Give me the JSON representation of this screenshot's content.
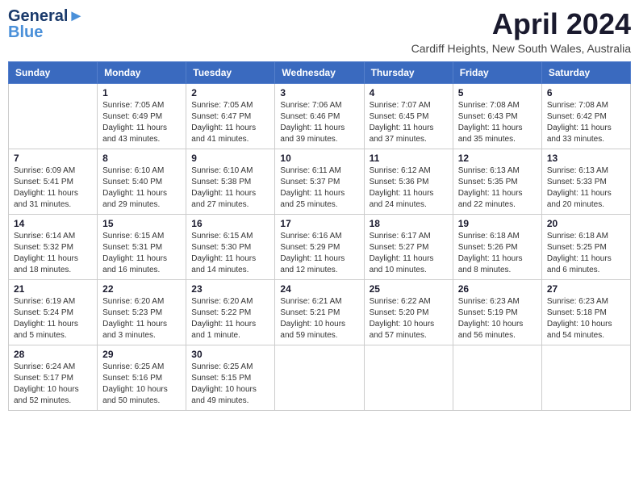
{
  "logo": {
    "line1": "General",
    "line2": "Blue"
  },
  "title": "April 2024",
  "location": "Cardiff Heights, New South Wales, Australia",
  "days_of_week": [
    "Sunday",
    "Monday",
    "Tuesday",
    "Wednesday",
    "Thursday",
    "Friday",
    "Saturday"
  ],
  "weeks": [
    [
      {
        "day": "",
        "info": ""
      },
      {
        "day": "1",
        "info": "Sunrise: 7:05 AM\nSunset: 6:49 PM\nDaylight: 11 hours\nand 43 minutes."
      },
      {
        "day": "2",
        "info": "Sunrise: 7:05 AM\nSunset: 6:47 PM\nDaylight: 11 hours\nand 41 minutes."
      },
      {
        "day": "3",
        "info": "Sunrise: 7:06 AM\nSunset: 6:46 PM\nDaylight: 11 hours\nand 39 minutes."
      },
      {
        "day": "4",
        "info": "Sunrise: 7:07 AM\nSunset: 6:45 PM\nDaylight: 11 hours\nand 37 minutes."
      },
      {
        "day": "5",
        "info": "Sunrise: 7:08 AM\nSunset: 6:43 PM\nDaylight: 11 hours\nand 35 minutes."
      },
      {
        "day": "6",
        "info": "Sunrise: 7:08 AM\nSunset: 6:42 PM\nDaylight: 11 hours\nand 33 minutes."
      }
    ],
    [
      {
        "day": "7",
        "info": "Sunrise: 6:09 AM\nSunset: 5:41 PM\nDaylight: 11 hours\nand 31 minutes."
      },
      {
        "day": "8",
        "info": "Sunrise: 6:10 AM\nSunset: 5:40 PM\nDaylight: 11 hours\nand 29 minutes."
      },
      {
        "day": "9",
        "info": "Sunrise: 6:10 AM\nSunset: 5:38 PM\nDaylight: 11 hours\nand 27 minutes."
      },
      {
        "day": "10",
        "info": "Sunrise: 6:11 AM\nSunset: 5:37 PM\nDaylight: 11 hours\nand 25 minutes."
      },
      {
        "day": "11",
        "info": "Sunrise: 6:12 AM\nSunset: 5:36 PM\nDaylight: 11 hours\nand 24 minutes."
      },
      {
        "day": "12",
        "info": "Sunrise: 6:13 AM\nSunset: 5:35 PM\nDaylight: 11 hours\nand 22 minutes."
      },
      {
        "day": "13",
        "info": "Sunrise: 6:13 AM\nSunset: 5:33 PM\nDaylight: 11 hours\nand 20 minutes."
      }
    ],
    [
      {
        "day": "14",
        "info": "Sunrise: 6:14 AM\nSunset: 5:32 PM\nDaylight: 11 hours\nand 18 minutes."
      },
      {
        "day": "15",
        "info": "Sunrise: 6:15 AM\nSunset: 5:31 PM\nDaylight: 11 hours\nand 16 minutes."
      },
      {
        "day": "16",
        "info": "Sunrise: 6:15 AM\nSunset: 5:30 PM\nDaylight: 11 hours\nand 14 minutes."
      },
      {
        "day": "17",
        "info": "Sunrise: 6:16 AM\nSunset: 5:29 PM\nDaylight: 11 hours\nand 12 minutes."
      },
      {
        "day": "18",
        "info": "Sunrise: 6:17 AM\nSunset: 5:27 PM\nDaylight: 11 hours\nand 10 minutes."
      },
      {
        "day": "19",
        "info": "Sunrise: 6:18 AM\nSunset: 5:26 PM\nDaylight: 11 hours\nand 8 minutes."
      },
      {
        "day": "20",
        "info": "Sunrise: 6:18 AM\nSunset: 5:25 PM\nDaylight: 11 hours\nand 6 minutes."
      }
    ],
    [
      {
        "day": "21",
        "info": "Sunrise: 6:19 AM\nSunset: 5:24 PM\nDaylight: 11 hours\nand 5 minutes."
      },
      {
        "day": "22",
        "info": "Sunrise: 6:20 AM\nSunset: 5:23 PM\nDaylight: 11 hours\nand 3 minutes."
      },
      {
        "day": "23",
        "info": "Sunrise: 6:20 AM\nSunset: 5:22 PM\nDaylight: 11 hours\nand 1 minute."
      },
      {
        "day": "24",
        "info": "Sunrise: 6:21 AM\nSunset: 5:21 PM\nDaylight: 10 hours\nand 59 minutes."
      },
      {
        "day": "25",
        "info": "Sunrise: 6:22 AM\nSunset: 5:20 PM\nDaylight: 10 hours\nand 57 minutes."
      },
      {
        "day": "26",
        "info": "Sunrise: 6:23 AM\nSunset: 5:19 PM\nDaylight: 10 hours\nand 56 minutes."
      },
      {
        "day": "27",
        "info": "Sunrise: 6:23 AM\nSunset: 5:18 PM\nDaylight: 10 hours\nand 54 minutes."
      }
    ],
    [
      {
        "day": "28",
        "info": "Sunrise: 6:24 AM\nSunset: 5:17 PM\nDaylight: 10 hours\nand 52 minutes."
      },
      {
        "day": "29",
        "info": "Sunrise: 6:25 AM\nSunset: 5:16 PM\nDaylight: 10 hours\nand 50 minutes."
      },
      {
        "day": "30",
        "info": "Sunrise: 6:25 AM\nSunset: 5:15 PM\nDaylight: 10 hours\nand 49 minutes."
      },
      {
        "day": "",
        "info": ""
      },
      {
        "day": "",
        "info": ""
      },
      {
        "day": "",
        "info": ""
      },
      {
        "day": "",
        "info": ""
      }
    ]
  ]
}
